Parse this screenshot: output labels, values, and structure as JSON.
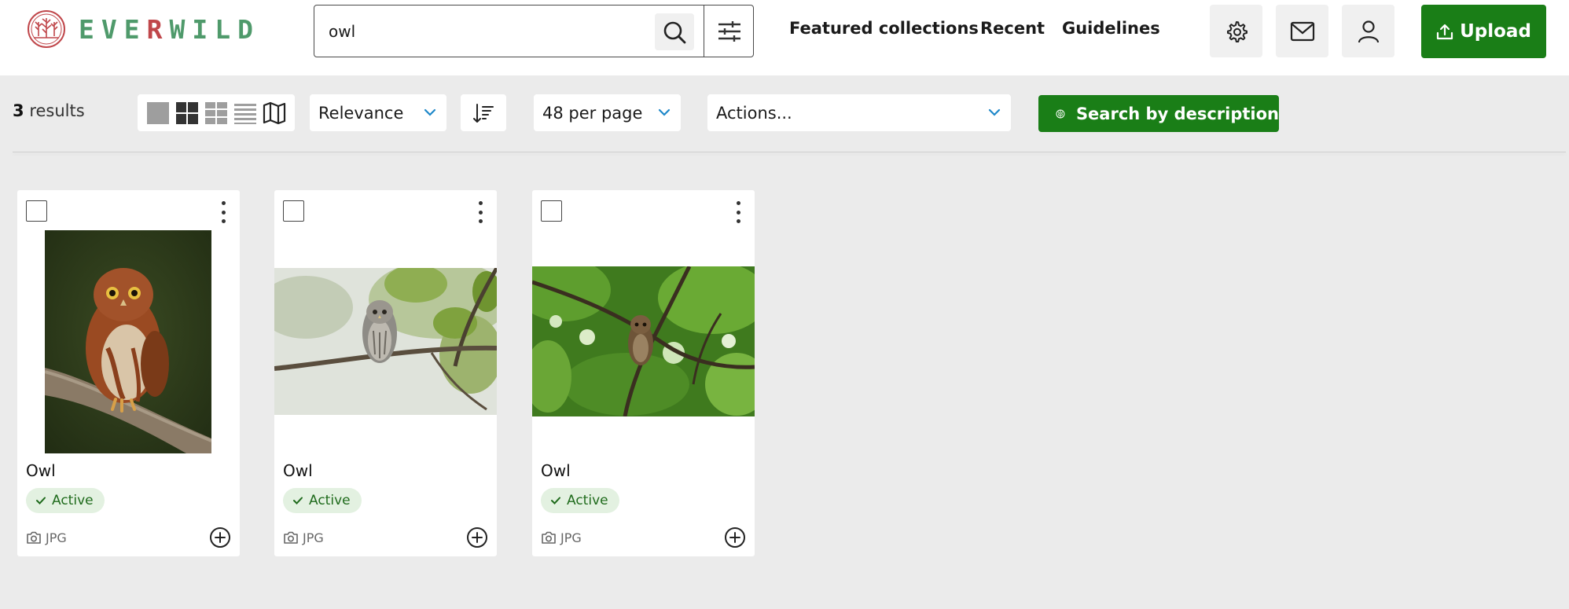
{
  "brand": {
    "name_start": "EVE",
    "name_accent": "R",
    "name_end": "WILD",
    "green": "#4f9a6b",
    "red": "#c0474b"
  },
  "search": {
    "value": "owl",
    "placeholder": ""
  },
  "nav": {
    "featured": "Featured collections",
    "recent": "Recent",
    "guidelines": "Guidelines"
  },
  "header_icons": [
    "gear-icon",
    "mail-icon",
    "user-icon"
  ],
  "upload": {
    "label": "Upload"
  },
  "toolbar": {
    "results_count": "3",
    "results_label": "results",
    "sort_by": "Relevance",
    "per_page": "48 per page",
    "actions": "Actions...",
    "search_by_description": "Search by description",
    "view_modes": [
      "large-thumbnail",
      "grid",
      "mixed",
      "list",
      "map"
    ]
  },
  "colors": {
    "accent_green": "#1a7e17",
    "badge_bg": "#e3f1e1",
    "badge_text": "#1f6b1c",
    "page_bg": "#ebebeb"
  },
  "cards": [
    {
      "title": "Owl",
      "status": "Active",
      "file_type": "JPG",
      "image": "red-brown owl perched on a branch"
    },
    {
      "title": "Owl",
      "status": "Active",
      "file_type": "JPG",
      "image": "grey owl on a branch among light leaves"
    },
    {
      "title": "Owl",
      "status": "Active",
      "file_type": "JPG",
      "image": "owl in a leafy green tree canopy"
    }
  ]
}
